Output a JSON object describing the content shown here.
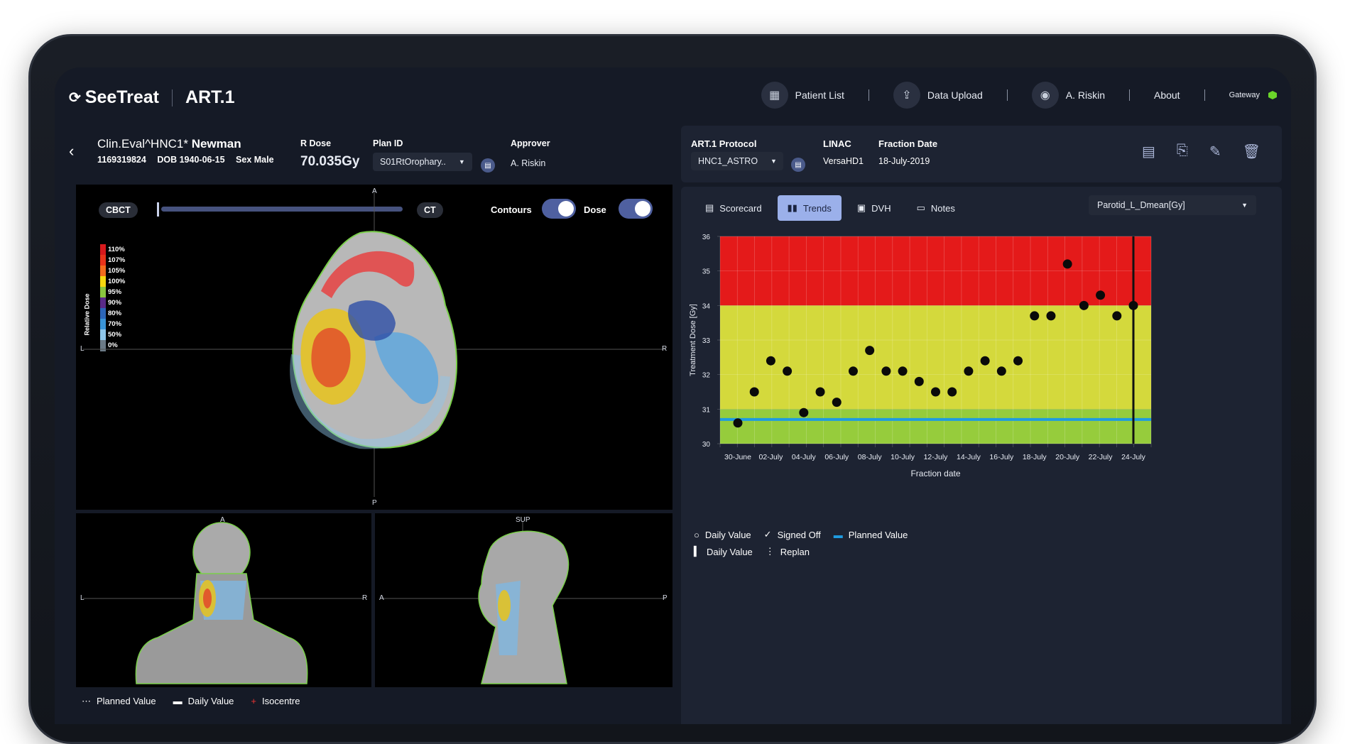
{
  "header": {
    "brand": "SeeTreat",
    "app": "ART.1",
    "nav": {
      "patient_list": "Patient List",
      "data_upload": "Data Upload",
      "user": "A. Riskin",
      "about": "About",
      "gateway": "Gateway"
    }
  },
  "patient": {
    "name_prefix": "Clin.Eval^HNC1*",
    "name_last": "Newman",
    "id": "1169319824",
    "dob_label": "DOB",
    "dob": "1940-06-15",
    "sex_label": "Sex",
    "sex": "Male",
    "rdose_label": "R Dose",
    "rdose": "70.035Gy",
    "plan_label": "Plan ID",
    "plan": "S01RtOrophary..",
    "approver_label": "Approver",
    "approver": "A. Riskin"
  },
  "viewer": {
    "cbct": "CBCT",
    "ct": "CT",
    "contours_label": "Contours",
    "dose_label": "Dose",
    "axis": {
      "a": "A",
      "p": "P",
      "l": "L",
      "r": "R",
      "sup": "SUP"
    },
    "colorbar_title": "Relative Dose",
    "colorbar": [
      {
        "label": "110%",
        "color": "#d7191c"
      },
      {
        "label": "107%",
        "color": "#e8331a"
      },
      {
        "label": "105%",
        "color": "#f26b1d"
      },
      {
        "label": "100%",
        "color": "#f5d80f"
      },
      {
        "label": "95%",
        "color": "#8ac63f"
      },
      {
        "label": "90%",
        "color": "#5a2a88"
      },
      {
        "label": "80%",
        "color": "#2c66b8"
      },
      {
        "label": "70%",
        "color": "#3a94d6"
      },
      {
        "label": "50%",
        "color": "#8fc6ea"
      },
      {
        "label": "0%",
        "color": "#6b7a86"
      }
    ],
    "legend": {
      "planned": "Planned Value",
      "daily": "Daily Value",
      "isocentre": "Isocentre"
    }
  },
  "right": {
    "protocol_label": "ART.1 Protocol",
    "protocol": "HNC1_ASTRO",
    "linac_label": "LINAC",
    "linac": "VersaHD1",
    "fraction_date_label": "Fraction Date",
    "fraction_date": "18-July-2019",
    "tabs": [
      "Scorecard",
      "Trends",
      "DVH",
      "Notes"
    ],
    "metric": "Parotid_L_Dmean[Gy]",
    "legend": {
      "daily": "Daily Value",
      "signed": "Signed Off",
      "planned": "Planned Value",
      "daily2": "Daily Value",
      "replan": "Replan"
    }
  },
  "chart_data": {
    "type": "scatter",
    "xlabel": "Fraction date",
    "ylabel": "Treatment Dose [Gy]",
    "ylim": [
      30,
      36
    ],
    "yticks": [
      30,
      31,
      32,
      33,
      34,
      35,
      36
    ],
    "xtick_labels": [
      "30-June",
      "02-July",
      "04-July",
      "06-July",
      "08-July",
      "10-July",
      "12-July",
      "14-July",
      "16-July",
      "18-July",
      "20-July",
      "22-July",
      "24-July"
    ],
    "zones": [
      {
        "from": 34,
        "to": 36,
        "color": "#e41a1a"
      },
      {
        "from": 31,
        "to": 34,
        "color": "#d4d93c"
      },
      {
        "from": 30,
        "to": 31,
        "color": "#96cc3c"
      }
    ],
    "planned_value": 30.7,
    "planned_color": "#1f9be0",
    "series": [
      {
        "values": [
          30.6,
          31.5,
          32.4,
          32.1,
          30.9,
          31.5,
          31.2,
          32.1,
          32.7,
          32.1,
          32.1,
          31.8,
          31.5,
          31.5,
          32.1,
          32.4,
          32.1,
          32.4,
          33.7,
          33.7,
          35.2,
          34.0,
          34.3,
          33.7,
          34.0
        ],
        "x": [
          "30-June",
          "01-July",
          "02-July",
          "03-July",
          "04-July",
          "05-July",
          "06-July",
          "07-July",
          "08-July",
          "09-July",
          "10-July",
          "11-July",
          "12-July",
          "13-July",
          "14-July",
          "15-July",
          "16-July",
          "17-July",
          "18-July",
          "19-July",
          "20-July",
          "21-July",
          "22-July",
          "23-July",
          "24-July"
        ]
      }
    ],
    "replan_marker": "24-July"
  }
}
